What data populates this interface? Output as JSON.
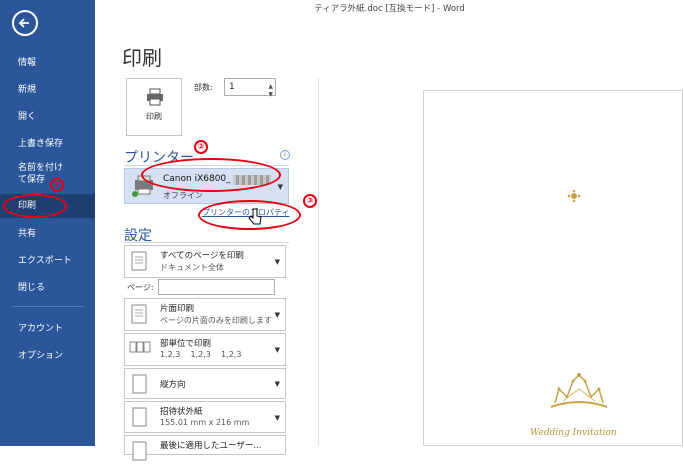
{
  "window": {
    "title": "ティアラ外紙.doc [互換モード] - Word"
  },
  "sidebar": {
    "items": [
      {
        "label": "情報"
      },
      {
        "label": "新規"
      },
      {
        "label": "開く"
      },
      {
        "label": "上書き保存"
      },
      {
        "label": "名前を付けて保存"
      },
      {
        "label": "印刷"
      },
      {
        "label": "共有"
      },
      {
        "label": "エクスポート"
      },
      {
        "label": "閉じる"
      },
      {
        "label": "アカウント"
      },
      {
        "label": "オプション"
      }
    ]
  },
  "print": {
    "heading": "印刷",
    "button_label": "印刷",
    "copies_label": "部数:",
    "copies_value": "1"
  },
  "printer": {
    "section_title": "プリンター",
    "name": "Canon iX6800_",
    "status": "オフライン",
    "properties_link": "プリンターのプロパティ"
  },
  "settings": {
    "section_title": "設定",
    "pages_label": "ページ:",
    "options": [
      {
        "line1": "すべてのページを印刷",
        "line2": "ドキュメント全体"
      },
      {
        "line1": "片面印刷",
        "line2": "ページの片面のみを印刷します"
      },
      {
        "line1": "部単位で印刷",
        "line2": "1,2,3    1,2,3    1,2,3"
      },
      {
        "line1": "縦方向",
        "line2": ""
      },
      {
        "line1": "招待状外紙",
        "line2": "155.01 mm x 216 mm"
      },
      {
        "line1": "最後に適用したユーザー...",
        "line2": ""
      }
    ]
  },
  "preview": {
    "caption": "Wedding Invitation"
  },
  "annotations": {
    "n1": "①",
    "n2": "②",
    "n3": "③"
  },
  "colors": {
    "sidebar": "#2b579a",
    "annotation": "#e60012",
    "gold": "#b8923a"
  }
}
